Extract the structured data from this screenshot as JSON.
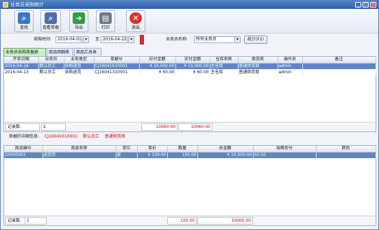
{
  "window": {
    "title": "业务员采购统计",
    "min": "_",
    "max": "□",
    "close": "x"
  },
  "toolbar": {
    "buttons": [
      {
        "label": "查找",
        "icon": "search-icon",
        "glyph": "⌕",
        "color": "#3b77c9"
      },
      {
        "label": "查看单据",
        "icon": "view-doc-icon",
        "glyph": "⌕",
        "color": "#4f6fa8"
      },
      {
        "label": "导出",
        "icon": "export-icon",
        "glyph": "➜",
        "color": "#2f9e44"
      },
      {
        "label": "打印",
        "icon": "printer-icon",
        "glyph": "▤",
        "color": "#6d7787"
      },
      {
        "label": "退出",
        "icon": "exit-icon",
        "glyph": "✕",
        "color": "#d9362b"
      }
    ]
  },
  "filters": {
    "date_label": "采购时间:",
    "date_from": "2016-04-01",
    "to_label": "至",
    "date_to": "2016-04-22",
    "clerk_label": "业务员名称:",
    "clerk_value": "所有业务员",
    "stat_button": "统计(F2)"
  },
  "tabs": [
    "业务员采购单据表",
    "商品明细表",
    "商品汇总表"
  ],
  "orders": {
    "columns": [
      "开单日期",
      "业务员",
      "业务类型",
      "单据号",
      "应付金额",
      "实付金额",
      "仓库名称",
      "供货商",
      "操作员",
      "备注"
    ],
    "rows": [
      [
        "2016-04-16",
        "默认员工",
        "采购进货",
        "CJ16041610001",
        "¥ 10,000.00",
        "¥ 10,000.00",
        "主仓库",
        "普通供货商",
        "admin",
        ""
      ],
      [
        "2016-04-13",
        "默认员工",
        "采购退货",
        "CJ16041310001",
        "¥ 60.00",
        "¥ 60.00",
        "主仓库",
        "普通供货商",
        "admin",
        ""
      ]
    ],
    "record_label": "记录数:",
    "record_count": "2",
    "total_payable": "10060.00",
    "total_paid": "10060.00"
  },
  "detail": {
    "label": "单据的详细信息:",
    "doc_no": "CJ16041610001",
    "clerk": "默认员工",
    "supplier": "普通供货商",
    "columns": [
      "商品编号",
      "商品名称",
      "单位",
      "单价",
      "数量",
      "总金额",
      "规格型号",
      "颜色"
    ],
    "rows": [
      [
        "20000003",
        "进货存",
        "套",
        "¥ 100.00",
        "100.00",
        "¥ 10,000.00",
        "50-50",
        ""
      ]
    ],
    "record_label": "记录数:",
    "record_count": "1",
    "total_qty": "100.00",
    "total_amount": "10000.00"
  },
  "colors": {
    "selection": "#5f85c4",
    "title_bar": "#2d5fa6",
    "total_text": "#cc0000"
  }
}
